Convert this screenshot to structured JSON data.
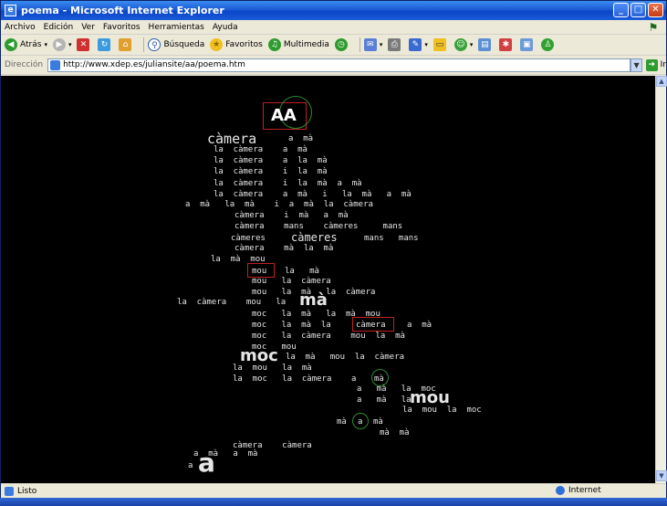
{
  "window": {
    "title": "poema - Microsoft Internet Explorer",
    "min": "_",
    "max": "□",
    "close": "✕"
  },
  "menu": [
    "Archivo",
    "Edición",
    "Ver",
    "Favoritos",
    "Herramientas",
    "Ayuda"
  ],
  "toolbar": {
    "back": "Atrás",
    "search": "Búsqueda",
    "favorites": "Favoritos",
    "media": "Multimedia"
  },
  "address": {
    "label": "Dirección",
    "url": "http://www.xdep.es/juliansite/aa/poema.htm",
    "go": "Ir"
  },
  "poem": {
    "title": "AA",
    "lines": [
      "càmera",
      "a  mà",
      "la  càmera    a  mà",
      "la  càmera    a  la  mà",
      "la  càmera    i  la  mà",
      "la  càmera    i  la  mà  a  mà",
      "la  càmera    a  mà   i   la  mà   a  mà",
      "a  mà   la  mà    i  a  mà  la  càmera",
      "càmera    i  mà   a  mà",
      "càmera    mans    càmeres     mans",
      "càmeres",
      "càmeres",
      "mans   mans",
      "càmera    mà  la  mà",
      "la  mà  mou",
      "mou",
      "la   mà",
      "mou   la  càmera",
      "mou   la  mà   la  càmera",
      "la  càmera    mou   la",
      "mà",
      "moc   la  mà   la  mà  mou",
      "moc   la  mà  la",
      "càmera",
      "a  mà",
      "moc   la  càmera    mou  la  mà",
      "moc   mou",
      "moc",
      "la  mà   mou  la  càmera",
      "la  mou   la  mà",
      "la  moc   la  càmera    a",
      "mà",
      "a   mà   la  moc",
      "a   mà   la",
      "mou",
      "la  mou  la  moc",
      "mà",
      "a",
      "mà",
      "mà  mà",
      "càmera    càmera",
      "a  mà   a  mà",
      "a",
      "a"
    ]
  },
  "status": {
    "text": "Listo",
    "zone": "Internet"
  },
  "icons": [
    "ie-icon",
    "back-icon",
    "forward-icon",
    "stop-icon",
    "refresh-icon",
    "home-icon",
    "search-icon",
    "favorites-icon",
    "media-icon",
    "history-icon",
    "mail-icon",
    "print-icon",
    "edit-icon",
    "messenger-icon",
    "globe-icon"
  ]
}
